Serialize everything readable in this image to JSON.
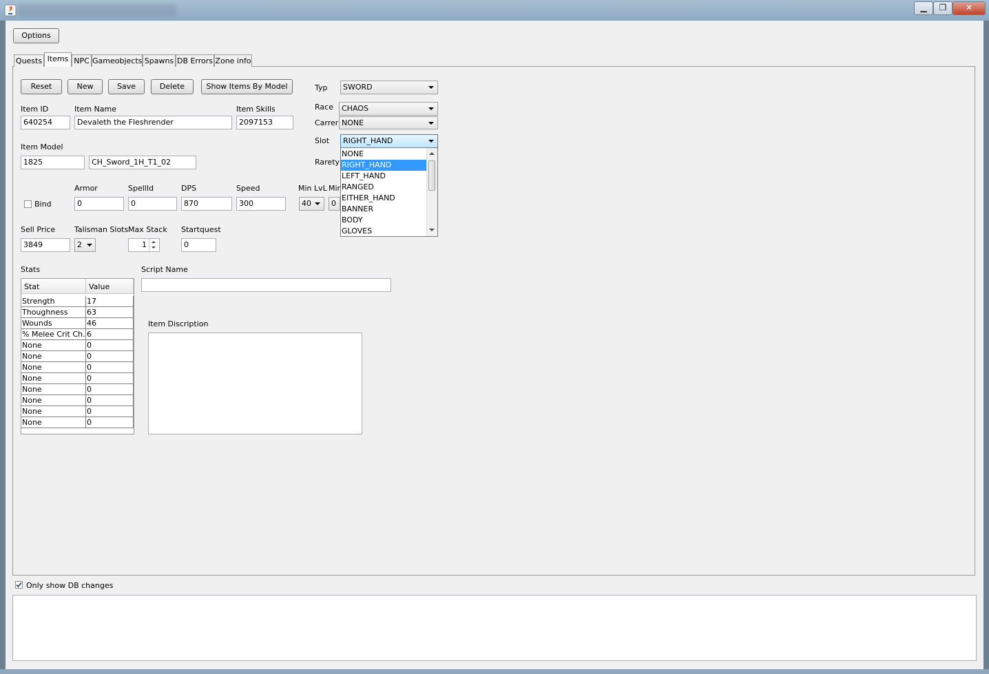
{
  "window": {
    "minimize_glyph": "▁",
    "maximize_glyph": "❐",
    "close_glyph": "✕"
  },
  "toolbar": {
    "options_label": "Options"
  },
  "tabs": [
    "Quests",
    "Items",
    "NPC",
    "Gameobjects",
    "Spawns",
    "DB Errors",
    "Zone info"
  ],
  "actions": {
    "reset": "Reset",
    "new": "New",
    "save": "Save",
    "delete": "Delete",
    "show_by_model": "Show Items By Model"
  },
  "item": {
    "id_label": "Item ID",
    "id": "640254",
    "name_label": "Item Name",
    "name": "Devaleth the Fleshrender",
    "skills_label": "Item Skills",
    "skills": "2097153",
    "model_label": "Item Model",
    "model_id": "1825",
    "model_name": "CH_Sword_1H_T1_02",
    "bind_label": "Bind",
    "armor_label": "Armor",
    "armor": "0",
    "spellid_label": "SpellId",
    "spellid": "0",
    "dps_label": "DPS",
    "dps": "870",
    "speed_label": "Speed",
    "speed": "300",
    "minlvl_label": "Min LvL",
    "minlvl": "40",
    "min2_label": "Min",
    "min2": "0",
    "sellprice_label": "Sell Price",
    "sellprice": "3849",
    "talisman_label": "Talisman Slots",
    "talisman": "2",
    "maxstack_label": "Max Stack",
    "maxstack": "1",
    "startquest_label": "Startquest",
    "startquest": "0",
    "stats_label": "Stats",
    "script_label": "Script Name",
    "script": "",
    "desc_label": "Item Discription",
    "desc": ""
  },
  "props": {
    "typ_label": "Typ",
    "typ": "SWORD",
    "race_label": "Race",
    "race": "CHAOS",
    "carrer_label": "Carrer",
    "carrer": "NONE",
    "slot_label": "Slot",
    "slot": "RIGHT_HAND",
    "rarety_label": "Rarety"
  },
  "slot_options": [
    "NONE",
    "RIGHT_HAND",
    "LEFT_HAND",
    "RANGED",
    "EITHER_HAND",
    "BANNER",
    "BODY",
    "GLOVES"
  ],
  "stats_table": {
    "headers": [
      "Stat",
      "Value"
    ],
    "rows": [
      [
        "Strength",
        "17"
      ],
      [
        "Thoughness",
        "63"
      ],
      [
        "Wounds",
        "46"
      ],
      [
        "% Melee Crit Ch...",
        "6"
      ],
      [
        "None",
        "0"
      ],
      [
        "None",
        "0"
      ],
      [
        "None",
        "0"
      ],
      [
        "None",
        "0"
      ],
      [
        "None",
        "0"
      ],
      [
        "None",
        "0"
      ],
      [
        "None",
        "0"
      ],
      [
        "None",
        "0"
      ]
    ]
  },
  "footer": {
    "only_db_changes_label": "Only show DB changes",
    "only_db_changes_checked": true,
    "log": ""
  }
}
